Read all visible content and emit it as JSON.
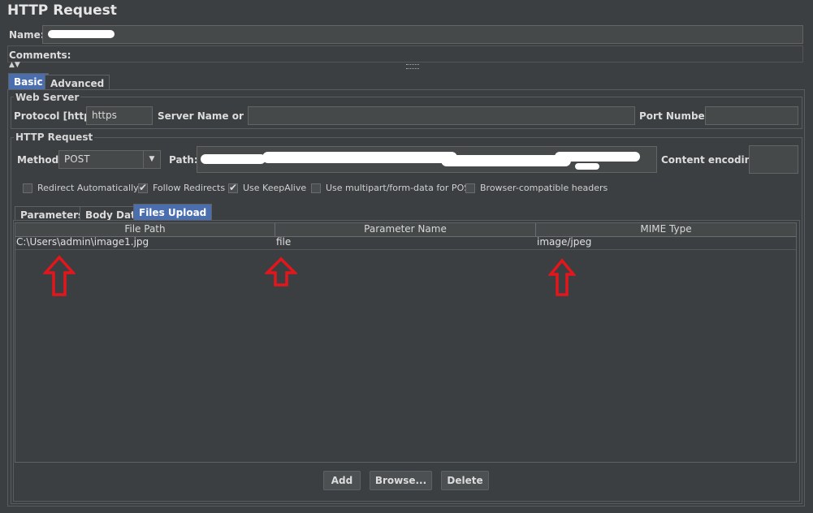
{
  "window": {
    "title": "HTTP Request"
  },
  "name_row": {
    "label": "Name:",
    "value": ""
  },
  "comments_row": {
    "label": "Comments:"
  },
  "top_tabs": [
    {
      "label": "Basic",
      "selected": true
    },
    {
      "label": "Advanced",
      "selected": false
    }
  ],
  "web_server": {
    "section_title": "Web Server",
    "protocol_label": "Protocol [http]:",
    "protocol_value": "https",
    "server_label": "Server Name or IP:",
    "server_value": "",
    "port_label": "Port Number:",
    "port_value": ""
  },
  "http_request": {
    "section_title": "HTTP Request",
    "method_label": "Method:",
    "method_value": "POST",
    "path_label": "Path:",
    "path_value": "",
    "encoding_label": "Content encoding:",
    "encoding_value": ""
  },
  "checkboxes": [
    {
      "label": "Redirect Automatically",
      "checked": false
    },
    {
      "label": "Follow Redirects",
      "checked": true
    },
    {
      "label": "Use KeepAlive",
      "checked": true
    },
    {
      "label": "Use multipart/form-data for POST",
      "checked": false
    },
    {
      "label": "Browser-compatible headers",
      "checked": false
    }
  ],
  "sub_tabs": [
    {
      "label": "Parameters",
      "selected": false
    },
    {
      "label": "Body Data",
      "selected": false
    },
    {
      "label": "Files Upload",
      "selected": true
    }
  ],
  "files_table": {
    "columns": [
      "File Path",
      "Parameter Name",
      "MIME Type"
    ],
    "rows": [
      [
        "C:\\Users\\admin\\image1.jpg",
        "file",
        "image/jpeg"
      ]
    ]
  },
  "buttons": {
    "add": "Add",
    "browse": "Browse...",
    "delete": "Delete"
  },
  "colors": {
    "background": "#3c3f41",
    "selected_tab": "#4b6eaf",
    "annotation_arrow": "#e3161c"
  }
}
